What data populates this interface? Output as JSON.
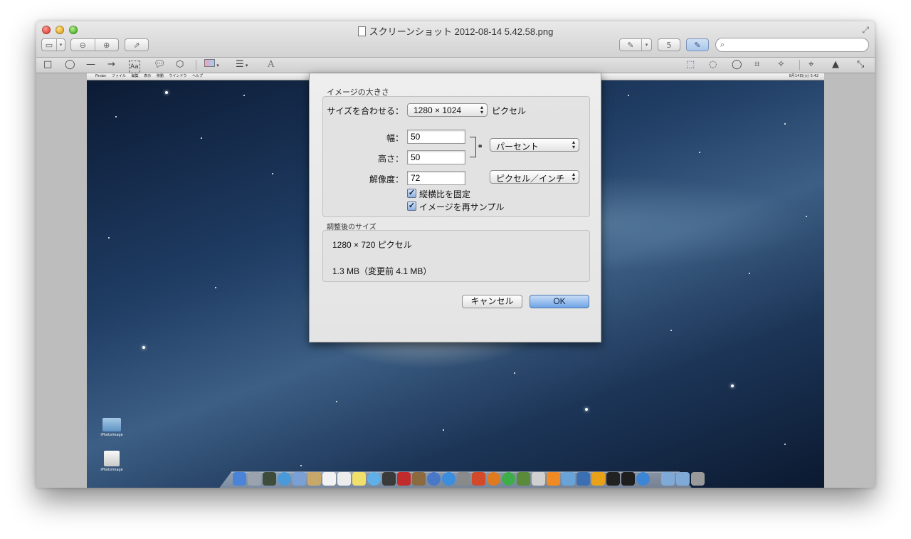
{
  "window": {
    "title": "スクリーンショット 2012-08-14 5.42.58.png"
  },
  "toolbar": {
    "badge_number": "5"
  },
  "edit_toolbar": {
    "text_tool": "A"
  },
  "desktop": {
    "menubar": {
      "items": [
        "Finder",
        "ファイル",
        "編集",
        "表示",
        "移動",
        "ウインドウ",
        "ヘルプ"
      ],
      "status": "8月14日(火) 5:42"
    },
    "icons": [
      {
        "label": "iPhotoImage"
      },
      {
        "label": "iPhotoImage"
      }
    ]
  },
  "dialog": {
    "image_size_label": "イメージの大きさ",
    "fit_label": "サイズを合わせる：",
    "fit_value": "1280 × 1024",
    "fit_unit": "ピクセル",
    "width_label": "幅：",
    "width_value": "50",
    "height_label": "高さ：",
    "height_value": "50",
    "unit_value": "パーセント",
    "resolution_label": "解像度：",
    "resolution_value": "72",
    "resolution_unit": "ピクセル／インチ",
    "constrain_label": "縦横比を固定",
    "constrain_checked": true,
    "resample_label": "イメージを再サンプル",
    "resample_checked": true,
    "result_label": "調整後のサイズ",
    "result_pixels": "1280 × 720 ピクセル",
    "result_size": "1.3 MB（変更前 4.1 MB）",
    "cancel_label": "キャンセル",
    "ok_label": "OK"
  }
}
